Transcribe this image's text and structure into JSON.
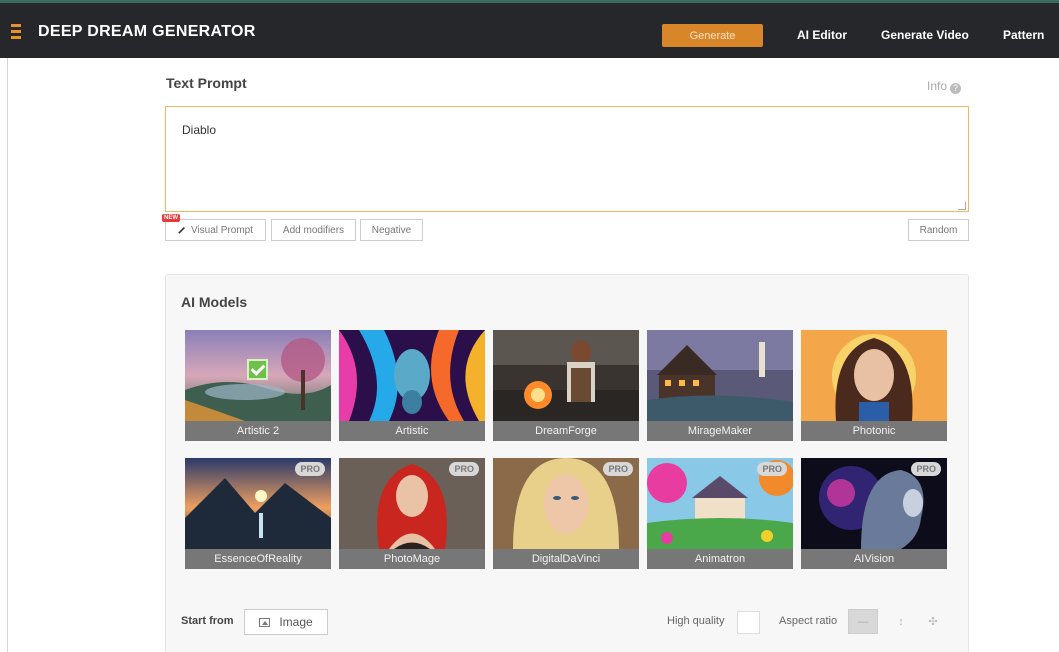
{
  "nav": {
    "brand": "DEEP DREAM GENERATOR",
    "generate": "Generate",
    "links": [
      "AI Editor",
      "Generate Video",
      "Pattern"
    ]
  },
  "text_prompt": {
    "title": "Text Prompt",
    "info": "Info",
    "value": "Diablo",
    "new_badge": "NEW",
    "visual_prompt": "Visual Prompt",
    "add_modifiers": "Add modifiers",
    "negative": "Negative",
    "random": "Random"
  },
  "models": {
    "title": "AI Models",
    "pro_label": "PRO",
    "items": [
      {
        "name": "Artistic 2",
        "pro": false,
        "selected": true
      },
      {
        "name": "Artistic",
        "pro": false,
        "selected": false
      },
      {
        "name": "DreamForge",
        "pro": false,
        "selected": false
      },
      {
        "name": "MirageMaker",
        "pro": false,
        "selected": false
      },
      {
        "name": "Photonic",
        "pro": false,
        "selected": false
      },
      {
        "name": "EssenceOfReality",
        "pro": true,
        "selected": false
      },
      {
        "name": "PhotoMage",
        "pro": true,
        "selected": false
      },
      {
        "name": "DigitalDaVinci",
        "pro": true,
        "selected": false
      },
      {
        "name": "Animatron",
        "pro": true,
        "selected": false
      },
      {
        "name": "AIVision",
        "pro": true,
        "selected": false
      }
    ]
  },
  "options": {
    "start_from": "Start from",
    "image_button": "Image",
    "high_quality": "High quality",
    "aspect_ratio": "Aspect ratio",
    "aspect_icons": [
      "landscape-icon",
      "portrait-icon",
      "square-icon"
    ]
  },
  "colors": {
    "accent": "#d9862a",
    "topbar": "#25272b",
    "prompt_border": "#efb663"
  }
}
